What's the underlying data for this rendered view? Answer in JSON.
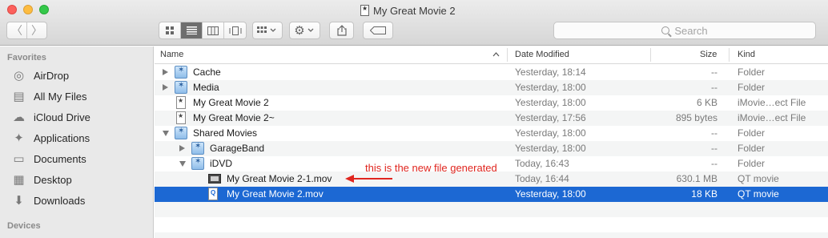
{
  "window": {
    "title": "My Great Movie 2"
  },
  "toolbar": {
    "back_glyph": "〈",
    "forward_glyph": "〉",
    "view_modes": [
      "icon-view-icon",
      "list-view-icon",
      "column-view-icon",
      "cover-flow-icon"
    ],
    "active_view": "list",
    "search_placeholder": "Search"
  },
  "sidebar": {
    "favorites_heading": "Favorites",
    "items": [
      {
        "label": "AirDrop",
        "icon": "airdrop-icon",
        "glyph": "◎"
      },
      {
        "label": "All My Files",
        "icon": "all-files-icon",
        "glyph": "▤"
      },
      {
        "label": "iCloud Drive",
        "icon": "cloud-icon",
        "glyph": "☁"
      },
      {
        "label": "Applications",
        "icon": "applications-icon",
        "glyph": "✦"
      },
      {
        "label": "Documents",
        "icon": "documents-icon",
        "glyph": "▭"
      },
      {
        "label": "Desktop",
        "icon": "desktop-icon",
        "glyph": "▦"
      },
      {
        "label": "Downloads",
        "icon": "downloads-icon",
        "glyph": "⬇"
      }
    ],
    "devices_heading": "Devices"
  },
  "list": {
    "columns": {
      "name": "Name",
      "date": "Date Modified",
      "size": "Size",
      "kind": "Kind"
    },
    "rows": [
      {
        "name": "Cache",
        "date": "Yesterday, 18:14",
        "size": "--",
        "kind": "Folder",
        "indent": 0,
        "disclosure": "closed",
        "icon": "folder"
      },
      {
        "name": "Media",
        "date": "Yesterday, 18:00",
        "size": "--",
        "kind": "Folder",
        "indent": 0,
        "disclosure": "closed",
        "icon": "folder"
      },
      {
        "name": "My Great Movie 2",
        "date": "Yesterday, 18:00",
        "size": "6 KB",
        "kind": "iMovie…ect File",
        "indent": 0,
        "disclosure": "none",
        "icon": "doc"
      },
      {
        "name": "My Great Movie 2~",
        "date": "Yesterday, 17:56",
        "size": "895 bytes",
        "kind": "iMovie…ect File",
        "indent": 0,
        "disclosure": "none",
        "icon": "doc"
      },
      {
        "name": "Shared Movies",
        "date": "Yesterday, 18:00",
        "size": "--",
        "kind": "Folder",
        "indent": 0,
        "disclosure": "open",
        "icon": "folder"
      },
      {
        "name": "GarageBand",
        "date": "Yesterday, 18:00",
        "size": "--",
        "kind": "Folder",
        "indent": 1,
        "disclosure": "closed",
        "icon": "folder"
      },
      {
        "name": "iDVD",
        "date": "Today, 16:43",
        "size": "--",
        "kind": "Folder",
        "indent": 1,
        "disclosure": "open",
        "icon": "folder"
      },
      {
        "name": "My Great Movie 2-1.mov",
        "date": "Today, 16:44",
        "size": "630.1 MB",
        "kind": "QT movie",
        "indent": 2,
        "disclosure": "none",
        "icon": "movie"
      },
      {
        "name": "My Great Movie 2.mov",
        "date": "Yesterday, 18:00",
        "size": "18 KB",
        "kind": "QT movie",
        "indent": 2,
        "disclosure": "none",
        "icon": "qt",
        "selected": true
      }
    ]
  },
  "annotation": {
    "text": "this is the new file generated",
    "color": "#e0261f"
  }
}
